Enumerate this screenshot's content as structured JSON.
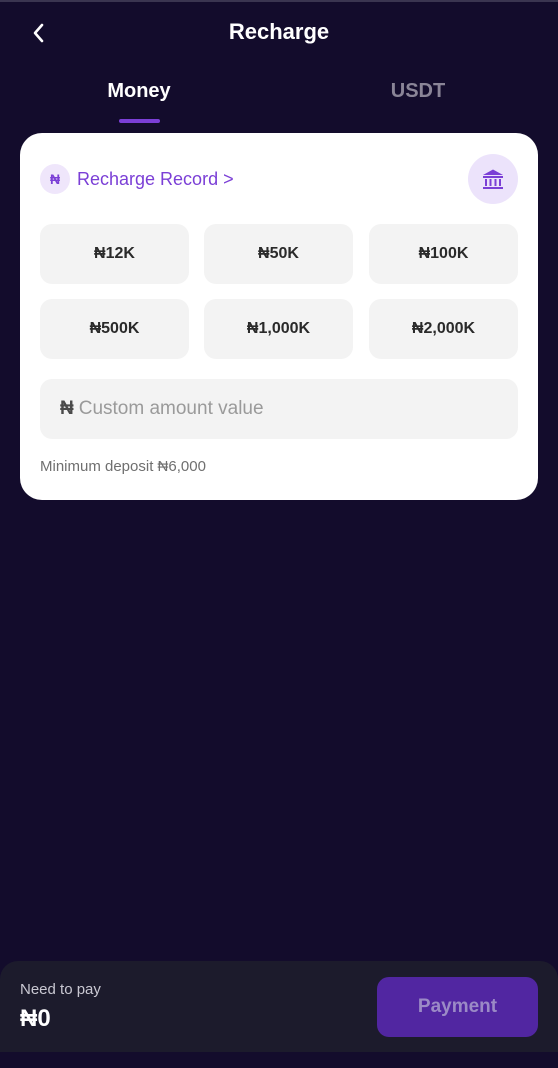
{
  "header": {
    "title": "Recharge",
    "back_icon": "chevron-left-icon"
  },
  "tabs": [
    {
      "label": "Money",
      "active": true
    },
    {
      "label": "USDT",
      "active": false
    }
  ],
  "card": {
    "currency_symbol": "₦",
    "record_label": "Recharge Record >",
    "bank_icon": "bank-icon",
    "amounts": [
      "₦12K",
      "₦50K",
      "₦100K",
      "₦500K",
      "₦1,000K",
      "₦2,000K"
    ],
    "custom_input": {
      "prefix": "₦",
      "placeholder": "Custom amount value"
    },
    "min_deposit": "Minimum deposit ₦6,000"
  },
  "footer": {
    "need_label": "Need to pay",
    "need_amount": "₦0",
    "pay_button": "Payment"
  },
  "colors": {
    "background": "#130c2c",
    "accent": "#7b3fd6",
    "button": "#5126a1"
  }
}
